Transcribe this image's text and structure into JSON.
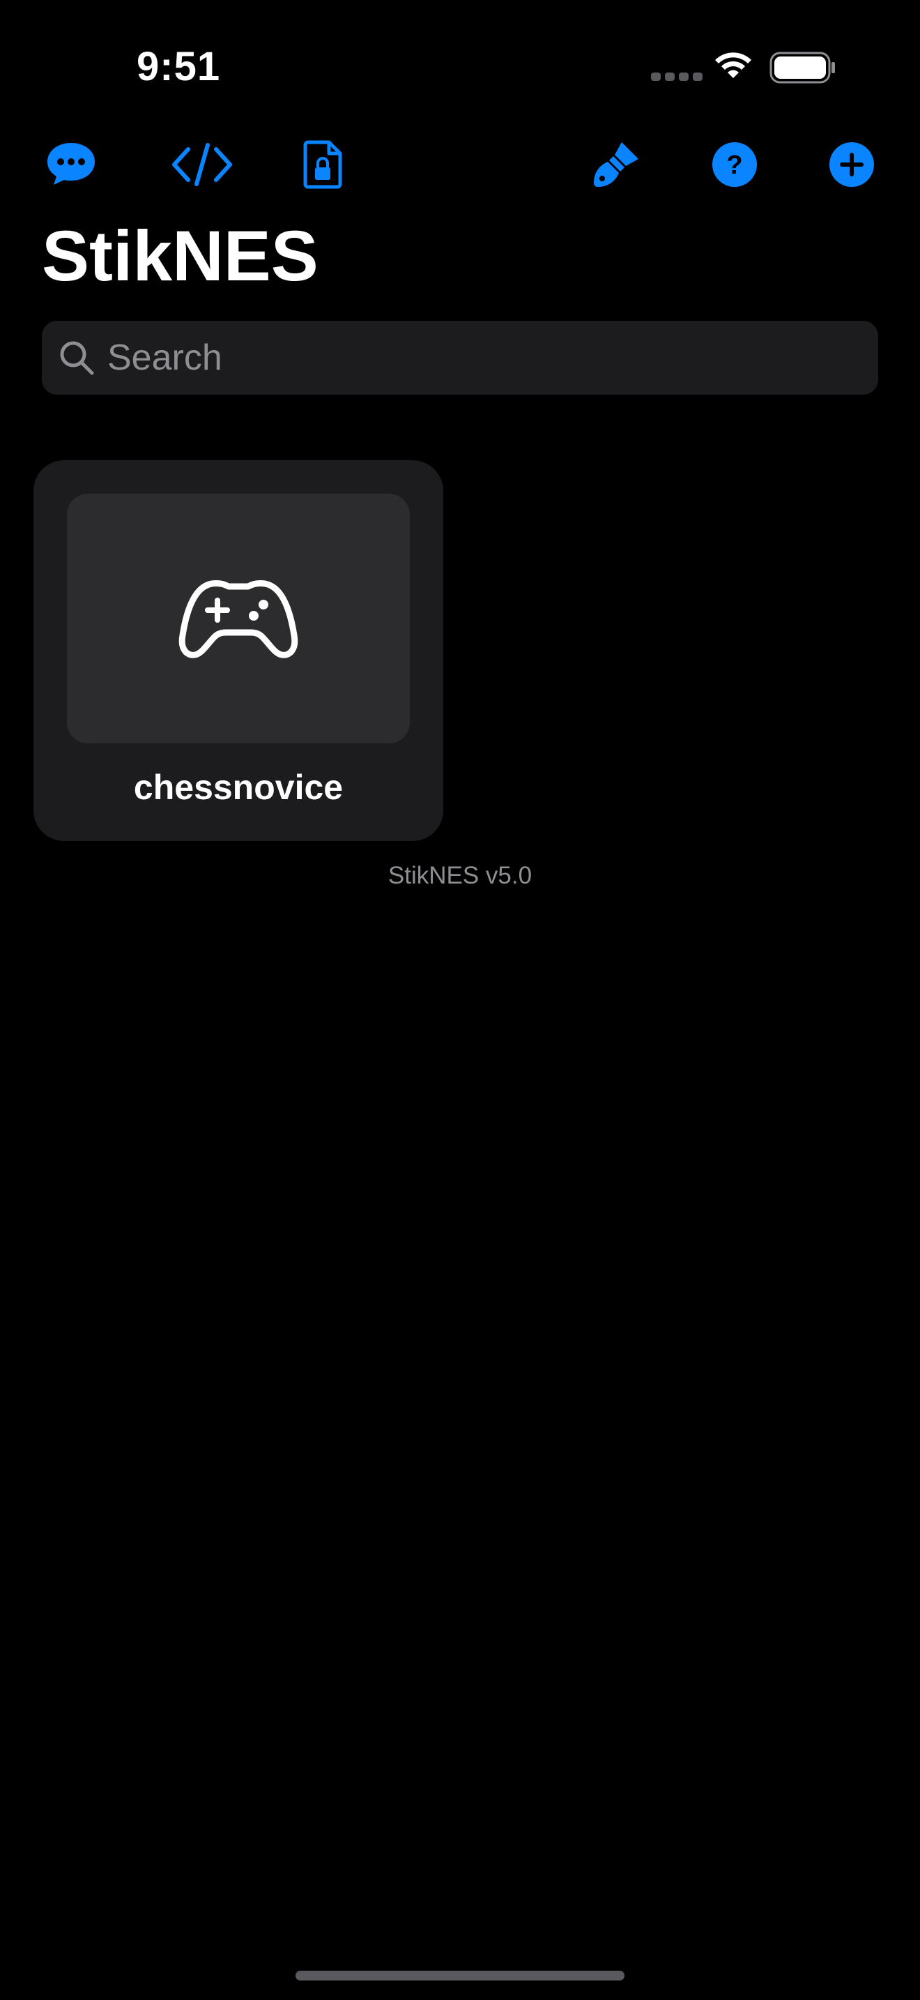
{
  "status_bar": {
    "time": "9:51"
  },
  "toolbar": {
    "icons": [
      "chat-bubble-icon",
      "code-icon",
      "locked-document-icon",
      "paintbrush-icon",
      "help-icon",
      "add-icon"
    ]
  },
  "colors": {
    "accent": "#0a84ff",
    "background": "#000000",
    "card": "#1c1c1e",
    "thumb": "#2c2c2e",
    "secondary_text": "#8e8e93"
  },
  "header": {
    "title": "StikNES"
  },
  "search": {
    "placeholder": "Search",
    "value": ""
  },
  "games": [
    {
      "title": "chessnovice",
      "icon": "gamepad-icon"
    }
  ],
  "footer": {
    "version": "StikNES v5.0"
  }
}
